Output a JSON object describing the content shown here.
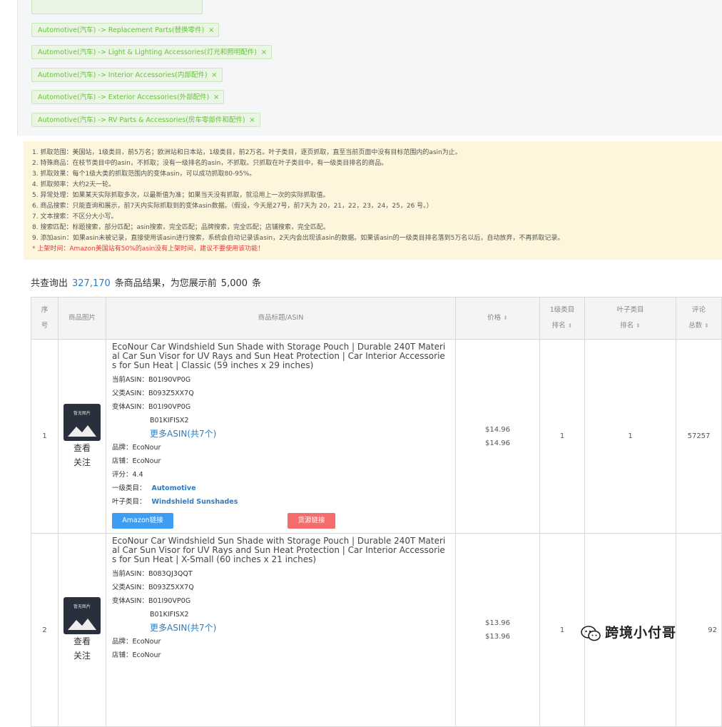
{
  "category_tags": [
    {
      "label": "Automotive(汽车) -> Replacement Parts(替换零件)"
    },
    {
      "label": "Automotive(汽车) -> Light & Lighting Accessories(灯光和照明配件)"
    },
    {
      "label": "Automotive(汽车) -> Interior Accessories(内部配件)"
    },
    {
      "label": "Automotive(汽车) -> Exterior Accessories(外部配件)"
    },
    {
      "label": "Automotive(汽车) -> RV Parts & Accessories(房车零部件和配件)"
    }
  ],
  "tag_close": "×",
  "notes": [
    "1. 抓取范围：美国站，1级类目，前5万名；欧洲站和日本站，1级类目，前2万名。叶子类目，逐页抓取，直至当前页面中没有目标范围内的asin为止。",
    "2. 特殊商品：在枝节类目中的asin，不抓取；没有一级排名的asin，不抓取。只抓取在叶子类目中，有一级类目排名的商品。",
    "3. 抓取效果：每个1级大类的抓取范围内的变体asin，可以成功抓取80-95%。",
    "4. 抓取频率：大约2天一轮。",
    "5. 异常处理：如果某天实际抓取多次，以最新值为准；如果当天没有抓取，就沿用上一次的实际抓取值。",
    "6. 商品搜索：只能查询和展示，前7天内实际抓取到的变体asin数据。（假设，今天是27号，前7天为 20，21，22，23，24，25，26 号。）",
    "7. 文本搜索：不区分大小写。",
    "8. 搜索匹配：标题搜索，部分匹配；asin搜索，完全匹配；品牌搜索，完全匹配；店铺搜索，完全匹配。",
    "9. 添加asin：如果asin未被记录，直接使用该asin进行搜索，系统会自动记录该asin，2天内会出现该asin的数据。如果该asin的一级类目排名落到5万名以后，自动放弃，不再抓取记录。"
  ],
  "notes_warning": "* 上架时间：Amazon美国站有50%的asin没有上架时间，建议不要使用该功能！",
  "summary": {
    "prefix": "共查询出",
    "total": "327,170",
    "middle": "条商品结果，为您展示前",
    "shown": "5,000",
    "suffix": "条"
  },
  "table": {
    "headers": {
      "index_a": "序",
      "index_b": "号",
      "image": "商品图片",
      "title": "商品标题/ASIN",
      "price": "价格",
      "rank1_a": "1级类目",
      "rank1_b": "排名",
      "leaf_a": "叶子类目",
      "leaf_b": "排名",
      "reviews_a": "评论",
      "reviews_b": "总数"
    },
    "sort_icon": "⬍",
    "no_image_label": "暂无图片",
    "action_view": "查看",
    "action_follow": "关注",
    "labels": {
      "current_asin": "当前ASIN：",
      "parent_asin": "父类ASIN：",
      "variant_asin": "变体ASIN：",
      "brand": "品牌：",
      "store": "店铺：",
      "rating": "评分：",
      "level1": "一级类目：",
      "leaf": "叶子类目："
    },
    "amazon_button": "Amazon链接",
    "source_button": "货源链接",
    "rows": [
      {
        "index": "1",
        "title": "EcoNour Car Windshield Sun Shade with Storage Pouch | Durable 240T Material Car Sun Visor for UV Rays and Sun Heat Protection | Car Interior Accessories for Sun Heat | Classic (59 inches x 29 inches)",
        "current_asin": "B01I90VP0G",
        "parent_asin": "B093Z5XX7Q",
        "variant_asin_1": "B01I90VP0G",
        "variant_asin_2": "B01KIFISX2",
        "more_asin": "更多ASIN(共7个)",
        "brand": "EcoNour",
        "store": "EcoNour",
        "rating": "4.4",
        "level1": "Automotive",
        "leaf": "Windshield Sunshades",
        "price_1": "$14.96",
        "price_2": "$14.96",
        "rank1": "1",
        "leaf_rank": "1",
        "reviews": "57257"
      },
      {
        "index": "2",
        "title": "EcoNour Car Windshield Sun Shade with Storage Pouch | Durable 240T Material Car Sun Visor for UV Rays and Sun Heat Protection | Car Interior Accessories for Sun Heat | X-Small (60 inches x 21 inches)",
        "current_asin": "B083QJ3QQT",
        "parent_asin": "B093Z5XX7Q",
        "variant_asin_1": "B01I90VP0G",
        "variant_asin_2": "B01KIFISX2",
        "more_asin": "更多ASIN(共7个)",
        "brand": "EcoNour",
        "store": "EcoNour",
        "price_1": "$13.96",
        "price_2": "$13.96",
        "rank1": "1",
        "reviews": "92"
      }
    ]
  },
  "watermark": "跨境小付哥"
}
